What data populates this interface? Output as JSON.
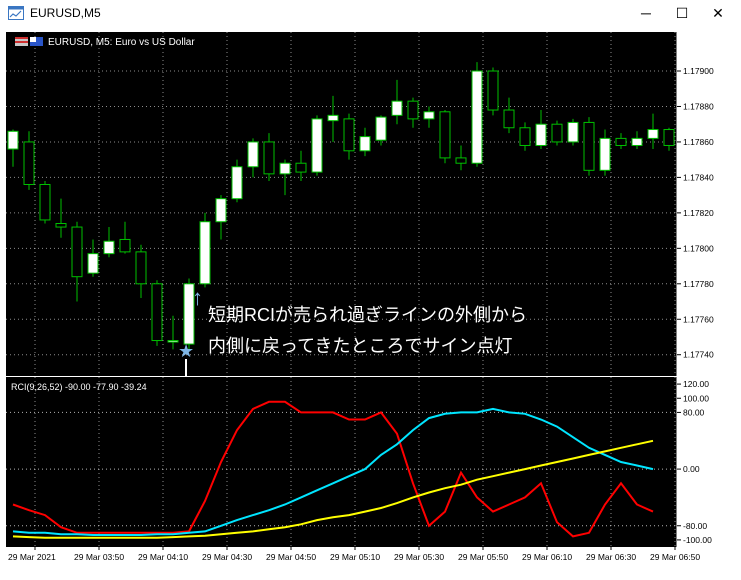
{
  "window": {
    "title": "EURUSD,M5",
    "minimize_label": "─",
    "maximize_label": "☐",
    "close_label": "✕"
  },
  "main_panel": {
    "label": "EURUSD, M5:  Euro vs US Dollar",
    "annotation_line1": "短期RCIが売られ過ぎラインの外側から",
    "annotation_line2": "内側に戻ってきたところでサイン点灯",
    "up_arrow_glyph": "↑",
    "star_glyph": "★"
  },
  "indicator_panel": {
    "label": "RCI(9,26,52) -90.00 -77.90 -39.24"
  },
  "colors": {
    "background": "#000000",
    "grid": "#ffffff",
    "bull_candle": "#ffffff",
    "bear_candle": "#000000",
    "candle_outline": "#00c000",
    "rci_short": "#ff0000",
    "rci_mid": "#00e5ff",
    "rci_long": "#ffff00",
    "annotation": "#ffffff",
    "up_arrow": "#7fb6e6",
    "star": "#7fb6e6"
  },
  "chart_data": [
    {
      "type": "candlestick",
      "symbol": "EURUSD",
      "timeframe": "M5",
      "y_ticks": [
        "1.17900",
        "1.17880",
        "1.17860",
        "1.17840",
        "1.17820",
        "1.17800",
        "1.17780",
        "1.17760",
        "1.17740"
      ],
      "ylim": [
        1.17728,
        1.17922
      ],
      "candles": [
        {
          "o": 1.17856,
          "h": 1.17867,
          "l": 1.17846,
          "c": 1.17866
        },
        {
          "o": 1.1786,
          "h": 1.17866,
          "l": 1.17833,
          "c": 1.17836
        },
        {
          "o": 1.17836,
          "h": 1.17838,
          "l": 1.17814,
          "c": 1.17816
        },
        {
          "o": 1.17814,
          "h": 1.17828,
          "l": 1.17806,
          "c": 1.17812
        },
        {
          "o": 1.17812,
          "h": 1.17815,
          "l": 1.1777,
          "c": 1.17784
        },
        {
          "o": 1.17786,
          "h": 1.17805,
          "l": 1.17784,
          "c": 1.17797
        },
        {
          "o": 1.17797,
          "h": 1.17812,
          "l": 1.17795,
          "c": 1.17804
        },
        {
          "o": 1.17805,
          "h": 1.17815,
          "l": 1.17797,
          "c": 1.17798
        },
        {
          "o": 1.17798,
          "h": 1.17802,
          "l": 1.17772,
          "c": 1.1778
        },
        {
          "o": 1.1778,
          "h": 1.17782,
          "l": 1.17745,
          "c": 1.17748
        },
        {
          "o": 1.17748,
          "h": 1.17762,
          "l": 1.17743,
          "c": 1.17748
        },
        {
          "o": 1.17746,
          "h": 1.17783,
          "l": 1.17743,
          "c": 1.1778
        },
        {
          "o": 1.1778,
          "h": 1.1782,
          "l": 1.17778,
          "c": 1.17815
        },
        {
          "o": 1.17815,
          "h": 1.1783,
          "l": 1.17805,
          "c": 1.17828
        },
        {
          "o": 1.17828,
          "h": 1.1785,
          "l": 1.17826,
          "c": 1.17846
        },
        {
          "o": 1.17846,
          "h": 1.17862,
          "l": 1.1784,
          "c": 1.1786
        },
        {
          "o": 1.1786,
          "h": 1.17865,
          "l": 1.17838,
          "c": 1.17842
        },
        {
          "o": 1.17842,
          "h": 1.1785,
          "l": 1.1783,
          "c": 1.17848
        },
        {
          "o": 1.17848,
          "h": 1.17855,
          "l": 1.17838,
          "c": 1.17843
        },
        {
          "o": 1.17843,
          "h": 1.17875,
          "l": 1.17841,
          "c": 1.17873
        },
        {
          "o": 1.17872,
          "h": 1.17886,
          "l": 1.1786,
          "c": 1.17875
        },
        {
          "o": 1.17873,
          "h": 1.17876,
          "l": 1.1785,
          "c": 1.17855
        },
        {
          "o": 1.17855,
          "h": 1.17868,
          "l": 1.17852,
          "c": 1.17863
        },
        {
          "o": 1.17861,
          "h": 1.17875,
          "l": 1.17858,
          "c": 1.17874
        },
        {
          "o": 1.17875,
          "h": 1.17895,
          "l": 1.1787,
          "c": 1.17883
        },
        {
          "o": 1.17883,
          "h": 1.17885,
          "l": 1.17868,
          "c": 1.17873
        },
        {
          "o": 1.17873,
          "h": 1.1788,
          "l": 1.17868,
          "c": 1.17877
        },
        {
          "o": 1.17877,
          "h": 1.17878,
          "l": 1.17848,
          "c": 1.17851
        },
        {
          "o": 1.17851,
          "h": 1.17858,
          "l": 1.17844,
          "c": 1.17848
        },
        {
          "o": 1.17848,
          "h": 1.17905,
          "l": 1.17846,
          "c": 1.179
        },
        {
          "o": 1.179,
          "h": 1.17902,
          "l": 1.17875,
          "c": 1.17878
        },
        {
          "o": 1.17878,
          "h": 1.17885,
          "l": 1.17865,
          "c": 1.17868
        },
        {
          "o": 1.17868,
          "h": 1.17871,
          "l": 1.17855,
          "c": 1.17858
        },
        {
          "o": 1.17858,
          "h": 1.17878,
          "l": 1.17856,
          "c": 1.1787
        },
        {
          "o": 1.1787,
          "h": 1.17872,
          "l": 1.17858,
          "c": 1.1786
        },
        {
          "o": 1.1786,
          "h": 1.17873,
          "l": 1.17858,
          "c": 1.17871
        },
        {
          "o": 1.17871,
          "h": 1.17874,
          "l": 1.17841,
          "c": 1.17844
        },
        {
          "o": 1.17844,
          "h": 1.17867,
          "l": 1.17841,
          "c": 1.17862
        },
        {
          "o": 1.17862,
          "h": 1.17865,
          "l": 1.17856,
          "c": 1.17858
        },
        {
          "o": 1.17858,
          "h": 1.17866,
          "l": 1.17856,
          "c": 1.17862
        },
        {
          "o": 1.17862,
          "h": 1.17876,
          "l": 1.17856,
          "c": 1.17867
        },
        {
          "o": 1.17867,
          "h": 1.17868,
          "l": 1.17855,
          "c": 1.17858
        }
      ],
      "signal_candle_index": 11
    },
    {
      "type": "line",
      "title": "RCI(9,26,52) -90.00 -77.90 -39.24",
      "y_ticks": [
        "120.00",
        "100.00",
        "80.00",
        "0.00",
        "-80.00",
        "-100.00"
      ],
      "ylim": [
        -110,
        130
      ],
      "x_tick_labels": [
        "29 Mar 2021",
        "29 Mar 03:50",
        "29 Mar 04:10",
        "29 Mar 04:30",
        "29 Mar 04:50",
        "29 Mar 05:10",
        "29 Mar 05:30",
        "29 Mar 05:50",
        "29 Mar 06:10",
        "29 Mar 06:30",
        "29 Mar 06:50"
      ],
      "series": [
        {
          "color": "#ff0000",
          "values": [
            -50,
            -58,
            -65,
            -82,
            -90,
            -90,
            -90,
            -90,
            -90,
            -90,
            -90,
            -88,
            -45,
            10,
            55,
            85,
            95,
            95,
            80,
            80,
            80,
            70,
            70,
            80,
            50,
            -20,
            -80,
            -60,
            -5,
            -40,
            -60,
            -50,
            -40,
            -20,
            -75,
            -95,
            -90,
            -50,
            -20,
            -50,
            -60
          ]
        },
        {
          "color": "#00e5ff",
          "values": [
            -88,
            -90,
            -90,
            -92,
            -92,
            -93,
            -93,
            -93,
            -93,
            -92,
            -92,
            -90,
            -88,
            -80,
            -72,
            -65,
            -58,
            -50,
            -40,
            -30,
            -20,
            -10,
            0,
            20,
            35,
            55,
            72,
            78,
            80,
            80,
            85,
            80,
            78,
            70,
            60,
            45,
            30,
            20,
            10,
            5,
            0
          ]
        },
        {
          "color": "#ffff00",
          "values": [
            -95,
            -96,
            -97,
            -97,
            -97,
            -97,
            -97,
            -97,
            -97,
            -97,
            -96,
            -95,
            -94,
            -92,
            -90,
            -88,
            -85,
            -82,
            -78,
            -72,
            -68,
            -65,
            -60,
            -55,
            -48,
            -40,
            -33,
            -27,
            -22,
            -15,
            -10,
            -5,
            0,
            5,
            10,
            15,
            20,
            25,
            30,
            35,
            40
          ]
        }
      ]
    }
  ]
}
